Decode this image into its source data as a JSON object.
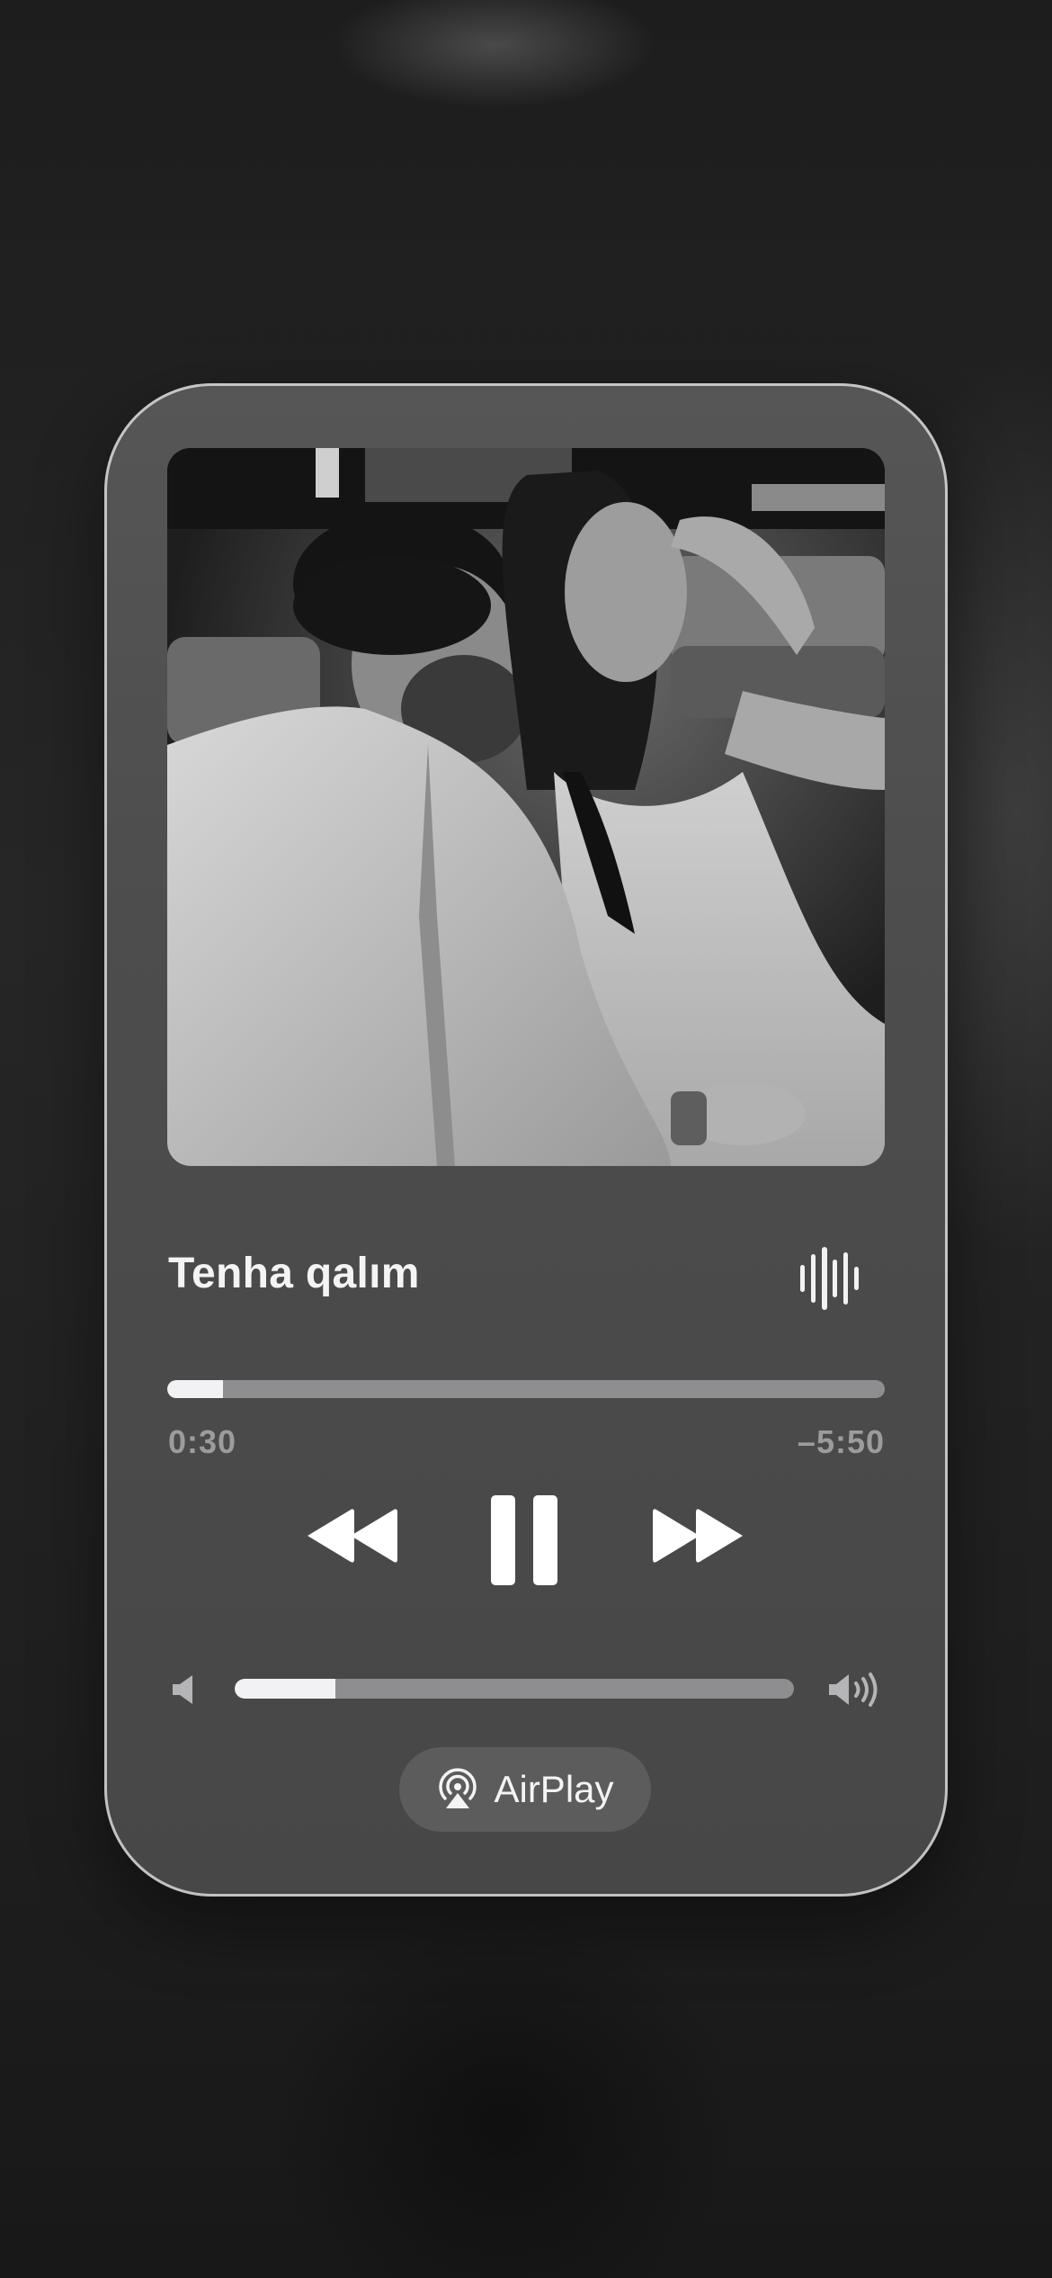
{
  "player": {
    "song_title": "Tenha qalım",
    "time_elapsed": "0:30",
    "time_remaining": "–5:50",
    "progress_fraction": 0.078,
    "volume_fraction": 0.18,
    "airplay_label": "AirPlay",
    "artwork_icon": "album-artwork-photo",
    "icons": {
      "waveform": "waveform-icon",
      "rewind": "backward-icon",
      "pause": "pause-icon",
      "forward": "forward-icon",
      "volume_low": "speaker-low-icon",
      "volume_high": "speaker-high-icon",
      "airplay": "airplay-icon"
    }
  }
}
